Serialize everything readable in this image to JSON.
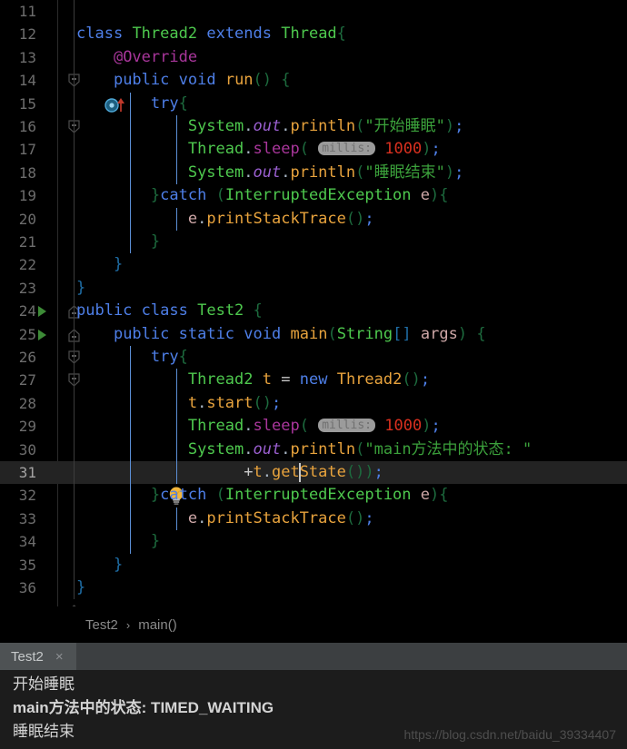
{
  "editor": {
    "first_visible_line": 11,
    "highlighted_line": 31,
    "caret_line": 31,
    "parameter_hint": "millis:",
    "lines": [
      {
        "n": "11",
        "text": ""
      },
      {
        "n": "12",
        "text": "class Thread2 extends Thread{"
      },
      {
        "n": "13",
        "text": "@Override"
      },
      {
        "n": "14",
        "text": "public void run() {"
      },
      {
        "n": "15",
        "text": "try{"
      },
      {
        "n": "16",
        "text": "System.out.println(\"开始睡眠\");"
      },
      {
        "n": "17",
        "text": "Thread.sleep( millis: 1000);"
      },
      {
        "n": "18",
        "text": "System.out.println(\"睡眠结束\");"
      },
      {
        "n": "19",
        "text": "}catch (InterruptedException e){"
      },
      {
        "n": "20",
        "text": "e.printStackTrace();"
      },
      {
        "n": "21",
        "text": "}"
      },
      {
        "n": "22",
        "text": "}"
      },
      {
        "n": "23",
        "text": "}"
      },
      {
        "n": "24",
        "text": "public class Test2 {"
      },
      {
        "n": "25",
        "text": "public static void main(String[] args) {"
      },
      {
        "n": "26",
        "text": "try{"
      },
      {
        "n": "27",
        "text": "Thread2 t = new Thread2();"
      },
      {
        "n": "28",
        "text": "t.start();"
      },
      {
        "n": "29",
        "text": "Thread.sleep( millis: 1000);"
      },
      {
        "n": "30",
        "text": "System.out.println(\"main方法中的状态: \""
      },
      {
        "n": "31",
        "text": "+t.getState());"
      },
      {
        "n": "32",
        "text": "}catch (InterruptedException e){"
      },
      {
        "n": "33",
        "text": "e.printStackTrace();"
      },
      {
        "n": "34",
        "text": "}"
      },
      {
        "n": "35",
        "text": "}"
      },
      {
        "n": "36",
        "text": "}"
      }
    ]
  },
  "breadcrumb": {
    "class_name": "Test2",
    "separator": "›",
    "method_name": "main()"
  },
  "console": {
    "tab_label": "Test2",
    "close_label": "×",
    "output": [
      {
        "text": "开始睡眠",
        "bold": false
      },
      {
        "text": "main方法中的状态: TIMED_WAITING",
        "bold": true
      },
      {
        "text": "睡眠结束",
        "bold": false
      }
    ]
  },
  "watermark": "https://blog.csdn.net/baidu_39334407",
  "colors": {
    "background": "#000000",
    "keyword": "#4e7fe8",
    "type": "#4ec94e",
    "annotation": "#a9369b",
    "method": "#e8a33d",
    "string": "#3ba13b",
    "number": "#d9301f",
    "field": "#9a5fd0",
    "line_number": "#6d6d6d",
    "highlight_line": "#232323",
    "console_tabbar": "#3c3f41",
    "console_bg": "#1c1c1c",
    "marker_stripe": "#2196ac",
    "run_arrow": "#3d8b37",
    "bulb": "#f0b33a",
    "override_icon": "#4fa8d8",
    "override_arrow": "#c0392b"
  },
  "gutter_icons": {
    "line14": "override-method-icon",
    "line24": "run-class-icon",
    "line25": "run-method-icon",
    "line31": "intention-bulb-icon"
  }
}
